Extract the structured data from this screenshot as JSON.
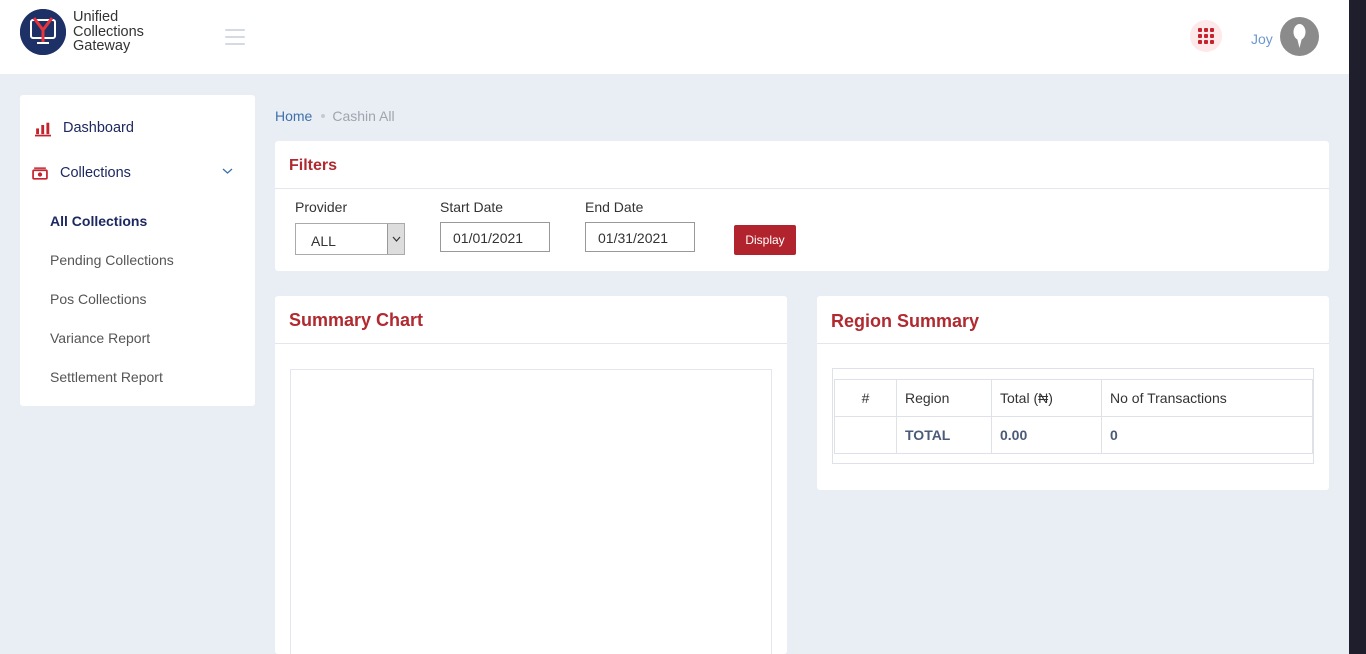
{
  "app": {
    "logo_line1": "Unified",
    "logo_line2": "Collections",
    "logo_line3": "Gateway"
  },
  "header": {
    "user_name": "Joy"
  },
  "sidebar": {
    "dashboard_label": "Dashboard",
    "collections_label": "Collections",
    "sub_items": [
      {
        "label": "All Collections",
        "active": true
      },
      {
        "label": "Pending Collections"
      },
      {
        "label": "Pos Collections"
      },
      {
        "label": "Variance Report"
      },
      {
        "label": "Settlement Report"
      }
    ]
  },
  "breadcrumb": {
    "home": "Home",
    "current": "Cashin All"
  },
  "filters": {
    "title": "Filters",
    "provider_label": "Provider",
    "provider_value": "ALL",
    "start_date_label": "Start Date",
    "start_date_value": "01/01/2021",
    "end_date_label": "End Date",
    "end_date_value": "01/31/2021",
    "display_button": "Display"
  },
  "summary_chart": {
    "title": "Summary Chart"
  },
  "region_summary": {
    "title": "Region Summary",
    "columns": [
      "#",
      "Region",
      "Total (₦)",
      "No of Transactions"
    ],
    "rows": [
      {
        "num": "",
        "region": "TOTAL",
        "total": "0.00",
        "transactions": "0"
      }
    ]
  },
  "colors": {
    "brand_red": "#b02a30",
    "brand_navy": "#1d2860",
    "link_blue": "#3e71ab"
  },
  "icons": [
    "logo-icon",
    "menu-icon",
    "apps-grid-icon",
    "user-avatar-icon",
    "bar-chart-icon",
    "money-icon",
    "chevron-down-icon"
  ]
}
